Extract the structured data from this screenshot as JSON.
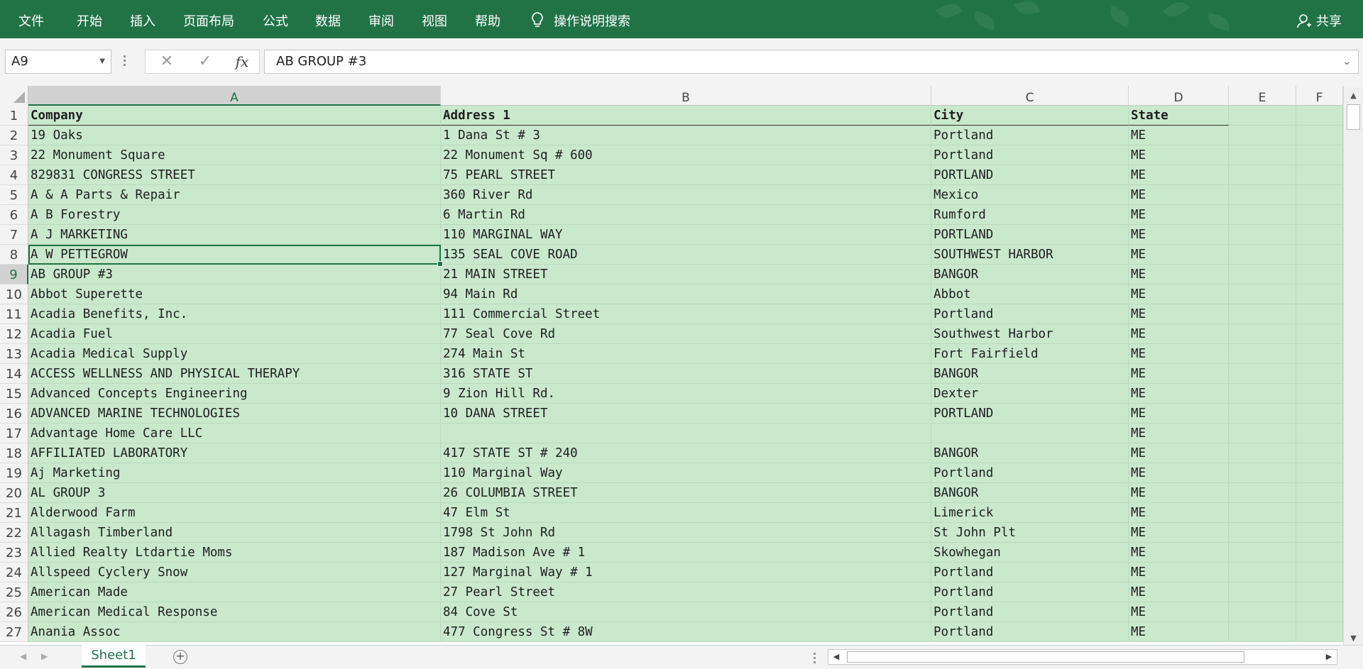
{
  "ribbon": {
    "tabs": [
      "文件",
      "开始",
      "插入",
      "页面布局",
      "公式",
      "数据",
      "审阅",
      "视图",
      "帮助"
    ],
    "tell_me": "操作说明搜索",
    "share": "共享",
    "bg_color": "#217346"
  },
  "formula_bar": {
    "name_box": "A9",
    "content": "AB GROUP #3",
    "cancel_icon": "✕",
    "enter_icon": "✓",
    "fx_label": "fx"
  },
  "columns": [
    "A",
    "B",
    "C",
    "D",
    "E",
    "F"
  ],
  "selected_column": "A",
  "selected_row": "9",
  "rows": [
    {
      "n": "1",
      "cells": [
        "Company",
        "Address 1",
        "City",
        "State",
        "",
        ""
      ]
    },
    {
      "n": "2",
      "cells": [
        "19 Oaks",
        "1 Dana St # 3",
        "Portland",
        "ME",
        "",
        ""
      ]
    },
    {
      "n": "3",
      "cells": [
        "22 Monument Square",
        "22 Monument Sq # 600",
        "Portland",
        "ME",
        "",
        ""
      ]
    },
    {
      "n": "4",
      "cells": [
        "829831 CONGRESS STREET",
        "75 PEARL STREET",
        "PORTLAND",
        "ME",
        "",
        ""
      ]
    },
    {
      "n": "5",
      "cells": [
        "A & A Parts & Repair",
        "360 River Rd",
        "Mexico",
        "ME",
        "",
        ""
      ]
    },
    {
      "n": "6",
      "cells": [
        "A B Forestry",
        "6 Martin Rd",
        "Rumford",
        "ME",
        "",
        ""
      ]
    },
    {
      "n": "7",
      "cells": [
        "A J MARKETING",
        "110 MARGINAL WAY",
        "PORTLAND",
        "ME",
        "",
        ""
      ]
    },
    {
      "n": "8",
      "cells": [
        "A W PETTEGROW",
        "135 SEAL COVE ROAD",
        "SOUTHWEST HARBOR",
        "ME",
        "",
        ""
      ]
    },
    {
      "n": "9",
      "cells": [
        "AB GROUP #3",
        "21 MAIN STREET",
        "BANGOR",
        "ME",
        "",
        ""
      ]
    },
    {
      "n": "10",
      "cells": [
        "Abbot Superette",
        "94 Main Rd",
        "Abbot",
        "ME",
        "",
        ""
      ]
    },
    {
      "n": "11",
      "cells": [
        "Acadia Benefits, Inc.",
        "111 Commercial Street",
        "Portland",
        "ME",
        "",
        ""
      ]
    },
    {
      "n": "12",
      "cells": [
        "Acadia Fuel",
        "77 Seal Cove Rd",
        "Southwest Harbor",
        "ME",
        "",
        ""
      ]
    },
    {
      "n": "13",
      "cells": [
        "Acadia Medical Supply",
        "274 Main St",
        "Fort Fairfield",
        "ME",
        "",
        ""
      ]
    },
    {
      "n": "14",
      "cells": [
        "ACCESS WELLNESS AND PHYSICAL THERAPY",
        "316 STATE ST",
        "BANGOR",
        "ME",
        "",
        ""
      ]
    },
    {
      "n": "15",
      "cells": [
        "Advanced Concepts Engineering",
        "9 Zion Hill Rd.",
        "Dexter",
        "ME",
        "",
        ""
      ]
    },
    {
      "n": "16",
      "cells": [
        "ADVANCED MARINE TECHNOLOGIES",
        "10 DANA STREET",
        "PORTLAND",
        "ME",
        "",
        ""
      ]
    },
    {
      "n": "17",
      "cells": [
        "Advantage Home Care LLC",
        "",
        "",
        "ME",
        "",
        ""
      ]
    },
    {
      "n": "18",
      "cells": [
        "AFFILIATED LABORATORY",
        "417 STATE ST # 240",
        "BANGOR",
        "ME",
        "",
        ""
      ]
    },
    {
      "n": "19",
      "cells": [
        "Aj Marketing",
        "110 Marginal Way",
        "Portland",
        "ME",
        "",
        ""
      ]
    },
    {
      "n": "20",
      "cells": [
        "AL GROUP 3",
        "26 COLUMBIA STREET",
        "BANGOR",
        "ME",
        "",
        ""
      ]
    },
    {
      "n": "21",
      "cells": [
        "Alderwood Farm",
        "47 Elm St",
        "Limerick",
        "ME",
        "",
        ""
      ]
    },
    {
      "n": "22",
      "cells": [
        "Allagash Timberland",
        "1798 St John Rd",
        "St John Plt",
        "ME",
        "",
        ""
      ]
    },
    {
      "n": "23",
      "cells": [
        "Allied Realty Ltdartie Moms",
        "187 Madison Ave # 1",
        "Skowhegan",
        "ME",
        "",
        ""
      ]
    },
    {
      "n": "24",
      "cells": [
        "Allspeed Cyclery Snow",
        "127 Marginal Way # 1",
        "Portland",
        "ME",
        "",
        ""
      ]
    },
    {
      "n": "25",
      "cells": [
        "American Made",
        "27 Pearl Street",
        "Portland",
        "ME",
        "",
        ""
      ]
    },
    {
      "n": "26",
      "cells": [
        "American Medical Response",
        "84 Cove St",
        "Portland",
        "ME",
        "",
        ""
      ]
    },
    {
      "n": "27",
      "cells": [
        "Anania Assoc",
        "477 Congress St # 8W",
        "Portland",
        "ME",
        "",
        ""
      ]
    }
  ],
  "sheets": [
    "Sheet1"
  ],
  "colors": {
    "fill": "#c9e8cc",
    "accent": "#217346"
  }
}
